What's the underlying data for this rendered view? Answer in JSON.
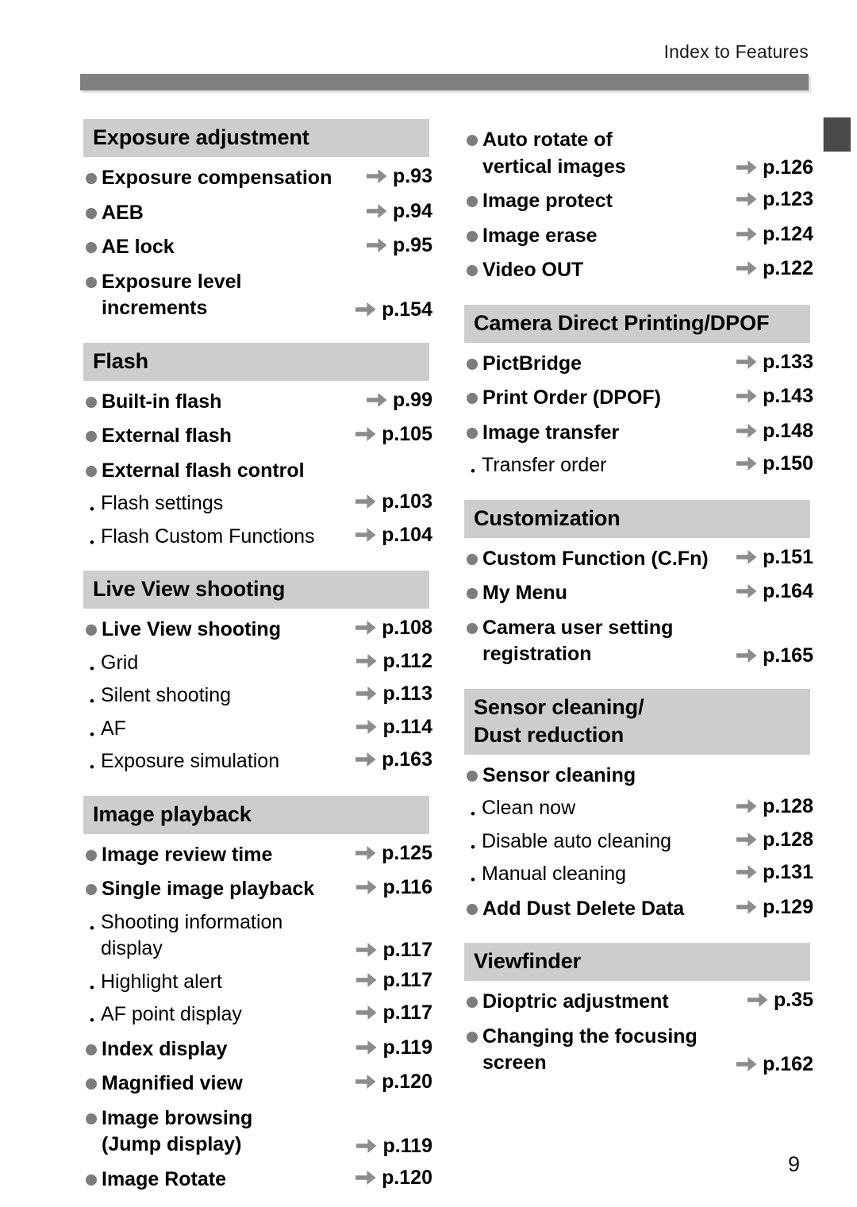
{
  "running_head": "Index to Features",
  "folio": "9",
  "colors": {
    "header_bar": "#808080",
    "section_band": "#cdcdcd",
    "bullet": "#7d7d7d",
    "arrow": "#8c8c8c",
    "side_tab": "#4a4a4a"
  },
  "left_column": [
    {
      "header": "Exposure adjustment",
      "entries": [
        {
          "level": "bullet",
          "label": "Exposure compensation",
          "page": "p.93"
        },
        {
          "level": "bullet",
          "label": "AEB",
          "page": "p.94"
        },
        {
          "level": "bullet",
          "label": "AE lock",
          "page": "p.95"
        },
        {
          "level": "bullet",
          "label": "Exposure level",
          "label2": "increments",
          "page": "p.154"
        }
      ]
    },
    {
      "header": "Flash",
      "entries": [
        {
          "level": "bullet",
          "label": "Built-in flash",
          "page": "p.99"
        },
        {
          "level": "bullet",
          "label": "External flash",
          "page": "p.105"
        },
        {
          "level": "bullet",
          "label": "External flash control",
          "page": ""
        },
        {
          "level": "dot",
          "label": "Flash settings",
          "page": "p.103"
        },
        {
          "level": "dot",
          "label": "Flash Custom Functions",
          "page": "p.104"
        }
      ]
    },
    {
      "header": "Live View shooting",
      "entries": [
        {
          "level": "bullet",
          "label": "Live View shooting",
          "page": "p.108"
        },
        {
          "level": "dot",
          "label": "Grid",
          "page": "p.112"
        },
        {
          "level": "dot",
          "label": "Silent shooting",
          "page": "p.113"
        },
        {
          "level": "dot",
          "label": "AF",
          "page": "p.114"
        },
        {
          "level": "dot",
          "label": "Exposure simulation",
          "page": "p.163"
        }
      ]
    },
    {
      "header": "Image playback",
      "entries": [
        {
          "level": "bullet",
          "label": "Image review time",
          "page": "p.125"
        },
        {
          "level": "bullet",
          "label": "Single image playback",
          "page": "p.116"
        },
        {
          "level": "dot",
          "label": "Shooting information",
          "label2": "display",
          "page": "p.117"
        },
        {
          "level": "dot",
          "label": "Highlight alert",
          "page": "p.117"
        },
        {
          "level": "dot",
          "label": "AF point display",
          "page": "p.117"
        },
        {
          "level": "bullet",
          "label": "Index display",
          "page": "p.119"
        },
        {
          "level": "bullet",
          "label": "Magnified view",
          "page": "p.120"
        },
        {
          "level": "bullet",
          "label": "Image browsing",
          "label2": "(Jump display)",
          "page": "p.119"
        },
        {
          "level": "bullet",
          "label": "Image Rotate",
          "page": "p.120"
        }
      ]
    }
  ],
  "right_column": [
    {
      "header": "",
      "entries": [
        {
          "level": "bullet",
          "label": "Auto rotate of",
          "label2": "vertical images",
          "page": "p.126"
        },
        {
          "level": "bullet",
          "label": "Image protect",
          "page": "p.123"
        },
        {
          "level": "bullet",
          "label": "Image erase",
          "page": "p.124"
        },
        {
          "level": "bullet",
          "label": "Video OUT",
          "page": "p.122"
        }
      ]
    },
    {
      "header": "Camera Direct Printing/DPOF",
      "entries": [
        {
          "level": "bullet",
          "label": "PictBridge",
          "page": "p.133"
        },
        {
          "level": "bullet",
          "label": "Print Order (DPOF)",
          "page": "p.143"
        },
        {
          "level": "bullet",
          "label": "Image transfer",
          "page": "p.148"
        },
        {
          "level": "dot",
          "label": "Transfer order",
          "page": "p.150"
        }
      ]
    },
    {
      "header": "Customization",
      "entries": [
        {
          "level": "bullet",
          "label": "Custom Function (C.Fn)",
          "page": "p.151"
        },
        {
          "level": "bullet",
          "label": "My Menu",
          "page": "p.164"
        },
        {
          "level": "bullet",
          "label": "Camera user setting",
          "label2": "registration",
          "page": "p.165"
        }
      ]
    },
    {
      "header": "Sensor cleaning/",
      "header2": "Dust reduction",
      "entries": [
        {
          "level": "bullet",
          "label": "Sensor cleaning",
          "page": ""
        },
        {
          "level": "dot",
          "label": "Clean now",
          "page": "p.128"
        },
        {
          "level": "dot",
          "label": "Disable auto cleaning",
          "page": "p.128"
        },
        {
          "level": "dot",
          "label": "Manual cleaning",
          "page": "p.131"
        },
        {
          "level": "bullet",
          "label": "Add Dust Delete Data",
          "page": "p.129"
        }
      ]
    },
    {
      "header": "Viewfinder",
      "entries": [
        {
          "level": "bullet",
          "label": "Dioptric adjustment",
          "page": "p.35"
        },
        {
          "level": "bullet",
          "label": "Changing the focusing",
          "label2": "screen",
          "page": "p.162"
        }
      ]
    }
  ]
}
